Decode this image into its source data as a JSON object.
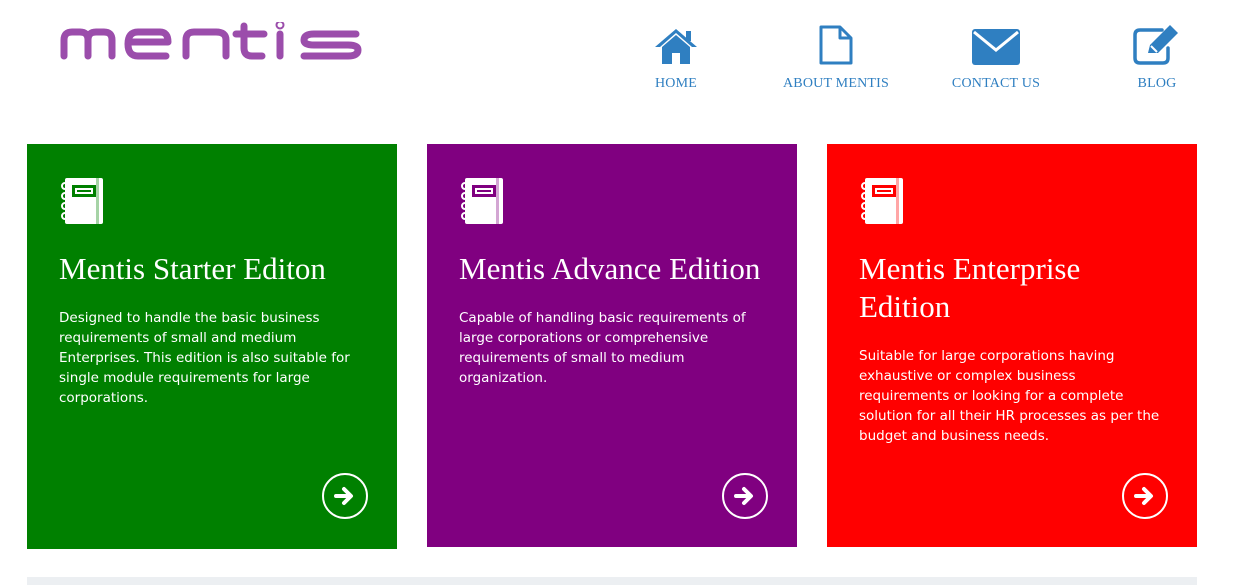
{
  "brand": {
    "logo_text": "mentis",
    "color": "#9b4dab"
  },
  "nav": {
    "color": "#2f7fc1",
    "items": [
      {
        "label": "HOME",
        "icon": "home-icon"
      },
      {
        "label": "ABOUT MENTIS",
        "icon": "document-icon"
      },
      {
        "label": "CONTACT US",
        "icon": "envelope-icon"
      },
      {
        "label": "BLOG",
        "icon": "edit-icon"
      }
    ]
  },
  "cards": [
    {
      "title": "Mentis Starter Editon",
      "description": "Designed to handle the basic business requirements of small and medium Enterprises. This edition is also suitable for single module requirements for large corporations.",
      "color": "#008000",
      "icon": "notebook-icon",
      "action_icon": "arrow-right-circle-icon"
    },
    {
      "title": "Mentis Advance Edition",
      "description": "Capable of handling basic requirements of large corporations or comprehensive requirements of small to medium organization.",
      "color": "#800080",
      "icon": "notebook-icon",
      "action_icon": "arrow-right-circle-icon"
    },
    {
      "title": "Mentis Enterprise Edition",
      "description": "Suitable for large corporations having exhaustive or complex business requirements or looking for a complete solution for all their HR processes as per the budget and business needs.",
      "color": "#ff0000",
      "icon": "notebook-icon",
      "action_icon": "arrow-right-circle-icon"
    }
  ]
}
